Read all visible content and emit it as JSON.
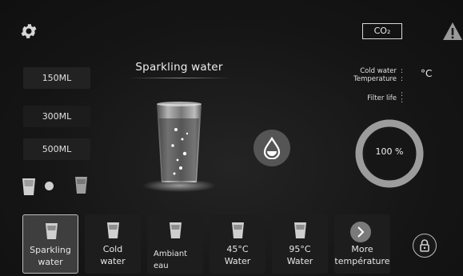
{
  "co2_label": "CO₂",
  "title": "Sparkling water",
  "volumes": [
    "150ML",
    "300ML",
    "500ML"
  ],
  "info": {
    "cold_water_label": "Cold water\nTemperature",
    "cold_colon": ":",
    "unit": "°C",
    "filter_label": "Filter life",
    "filter_colon": ":"
  },
  "filter_value": "100 %",
  "filter_fraction": 1.0,
  "tabs": [
    {
      "label": "Sparkling\nwater"
    },
    {
      "label": "Cold\nwater"
    },
    {
      "label": "Ambiant\neau"
    },
    {
      "label": "45°C\nWater"
    },
    {
      "label": "95°C\nWater"
    },
    {
      "label": "More\ntempérature"
    }
  ],
  "icons": {
    "settings": "gear-icon",
    "warning": "warning-icon",
    "dispense": "water-drop-icon",
    "lock": "lock-icon",
    "more": "chevron-right-icon"
  },
  "colors": {
    "background": "#141414",
    "accent": "#d0d0d0"
  }
}
